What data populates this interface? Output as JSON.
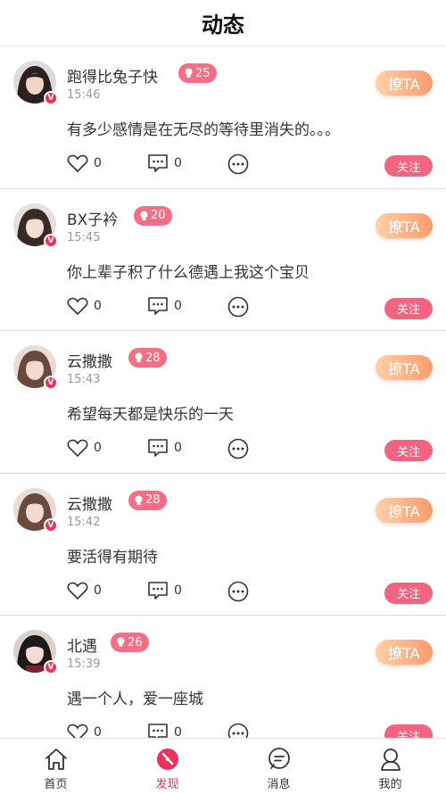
{
  "header": {
    "title": "动态"
  },
  "posts": [
    {
      "name": "跑得比兔子快",
      "level": "25",
      "time": "15:46",
      "content": "有多少感情是在无尽的等待里消失的。。。",
      "likes": "0",
      "comments": "0",
      "flirt_label": "撩TA",
      "follow_label": "关注",
      "avatar_hair": "#2b1f1f",
      "avatar_skin": "#f1d6c8"
    },
    {
      "name": "BX子衿",
      "level": "20",
      "time": "15:45",
      "content": "你上辈子积了什么德遇上我这个宝贝",
      "likes": "0",
      "comments": "0",
      "flirt_label": "撩TA",
      "follow_label": "关注",
      "avatar_hair": "#3a2a26",
      "avatar_skin": "#f5ddd2"
    },
    {
      "name": "云撒撒",
      "level": "28",
      "time": "15:43",
      "content": "希望每天都是快乐的一天",
      "likes": "0",
      "comments": "0",
      "flirt_label": "撩TA",
      "follow_label": "关注",
      "avatar_hair": "#6b4a3e",
      "avatar_skin": "#f4d9d0"
    },
    {
      "name": "云撒撒",
      "level": "28",
      "time": "15:42",
      "content": "要活得有期待",
      "likes": "0",
      "comments": "0",
      "flirt_label": "撩TA",
      "follow_label": "关注",
      "avatar_hair": "#6b4a3e",
      "avatar_skin": "#f4d9d0"
    },
    {
      "name": "北遇",
      "level": "26",
      "time": "15:39",
      "content": "遇一个人，爱一座城",
      "likes": "0",
      "comments": "0",
      "flirt_label": "撩TA",
      "follow_label": "关注",
      "avatar_hair": "#1e1a1a",
      "avatar_skin": "#f3dcd3"
    }
  ],
  "tabbar": {
    "items": [
      {
        "label": "首页",
        "icon": "home-icon",
        "active": false
      },
      {
        "label": "发现",
        "icon": "discover-icon",
        "active": true
      },
      {
        "label": "消息",
        "icon": "message-icon",
        "active": false
      },
      {
        "label": "我的",
        "icon": "profile-icon",
        "active": false
      }
    ]
  },
  "colors": {
    "accent": "#e8345a",
    "level_badge": "#f46f86",
    "follow_button": "#f2647f",
    "flirt_gradient_start": "#ffd0a8",
    "flirt_gradient_end": "#fa9c6e"
  }
}
